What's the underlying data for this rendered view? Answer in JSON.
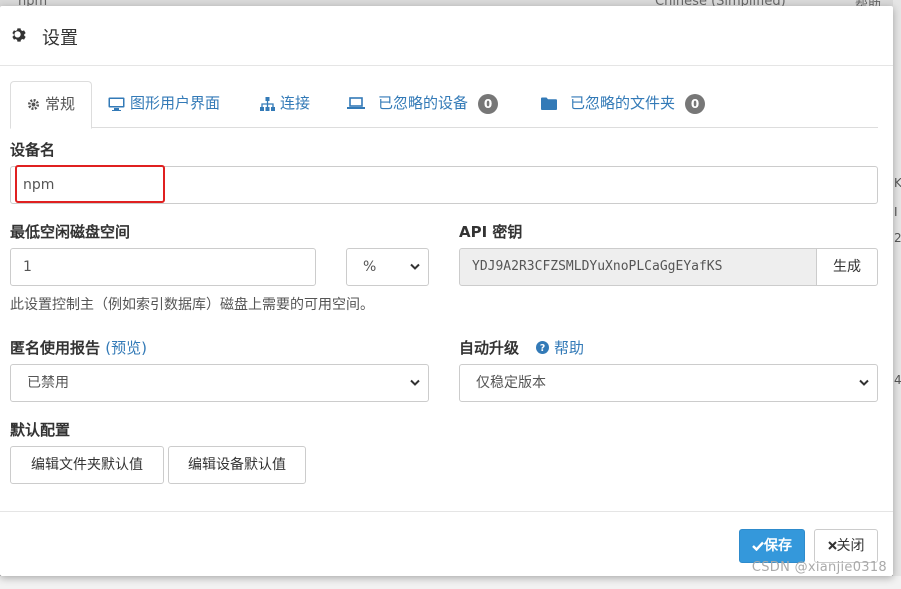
{
  "background": {
    "top_left_text": "npm",
    "top_right_language": "Chinese (Simplified)",
    "top_right_help": "帮助",
    "right_edge_chars": [
      "K",
      "I",
      "2",
      "4"
    ]
  },
  "dialog": {
    "title": "设置",
    "icon": "gear-icon"
  },
  "tabs": [
    {
      "label": "常规",
      "icon": "gear-icon",
      "active": true
    },
    {
      "label": "图形用户界面",
      "icon": "desktop-icon",
      "active": false
    },
    {
      "label": "连接",
      "icon": "sitemap-icon",
      "active": false
    },
    {
      "label": "已忽略的设备",
      "icon": "laptop-icon",
      "badge": "0",
      "active": false
    },
    {
      "label": "已忽略的文件夹",
      "icon": "folder-icon",
      "badge": "0",
      "active": false
    }
  ],
  "device_name": {
    "label": "设备名",
    "value": "npm"
  },
  "min_disk": {
    "label": "最低空闲磁盘空间",
    "value": "1",
    "unit": "%",
    "help": "此设置控制主（例如索引数据库）磁盘上需要的可用空间。"
  },
  "api_key": {
    "label": "API 密钥",
    "value": "YDJ9A2R3CFZSMLDYuXnoPLCaGgEYafKS",
    "generate_label": "生成"
  },
  "usage_report": {
    "label": "匿名使用报告",
    "preview_label": "(预览)",
    "value": "已禁用"
  },
  "auto_upgrade": {
    "label": "自动升级",
    "help_label": "帮助",
    "value": "仅稳定版本"
  },
  "default_config": {
    "label": "默认配置",
    "edit_folder_defaults": "编辑文件夹默认值",
    "edit_device_defaults": "编辑设备默认值"
  },
  "footer": {
    "save_label": "保存",
    "close_label": "关闭"
  },
  "watermark": "CSDN @xianjie0318",
  "colors": {
    "link": "#337ab7",
    "primary": "#3498db",
    "badge": "#777777",
    "highlight": "#e02020"
  }
}
